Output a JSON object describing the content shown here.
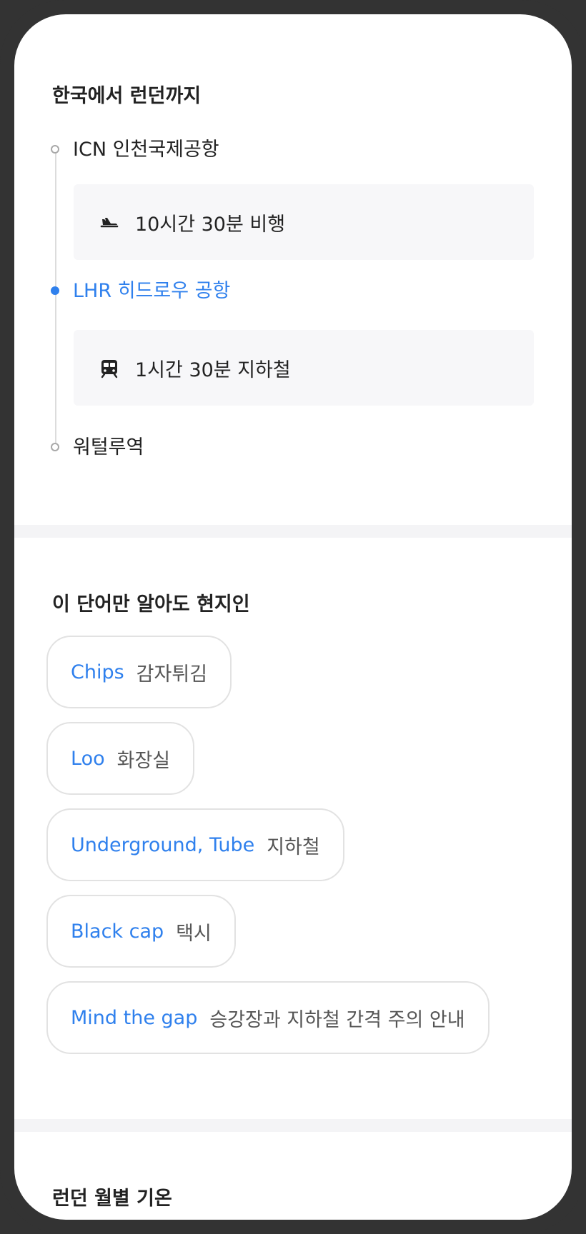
{
  "route_section": {
    "title": "한국에서 런던까지",
    "stops": [
      {
        "label": "ICN 인천국제공항",
        "active": false
      },
      {
        "label": "LHR 히드로우 공항",
        "active": true
      },
      {
        "label": "워털루역",
        "active": false
      }
    ],
    "legs": [
      {
        "icon": "airplane-landing-icon",
        "text": "10시간 30분 비행"
      },
      {
        "icon": "subway-train-icon",
        "text": "1시간 30분 지하철"
      }
    ]
  },
  "words_section": {
    "title": "이 단어만 알아도 현지인",
    "words": [
      {
        "en": "Chips",
        "ko": "감자튀김"
      },
      {
        "en": "Loo",
        "ko": "화장실"
      },
      {
        "en": "Underground, Tube",
        "ko": "지하철"
      },
      {
        "en": "Black cap",
        "ko": "택시"
      },
      {
        "en": "Mind the gap",
        "ko": "승강장과 지하철 간격 주의 안내"
      }
    ]
  },
  "weather_section": {
    "title": "런던 월별 기온"
  },
  "colors": {
    "accent": "#2f80ed",
    "frame": "#333333",
    "card_bg": "#f7f7f9"
  }
}
